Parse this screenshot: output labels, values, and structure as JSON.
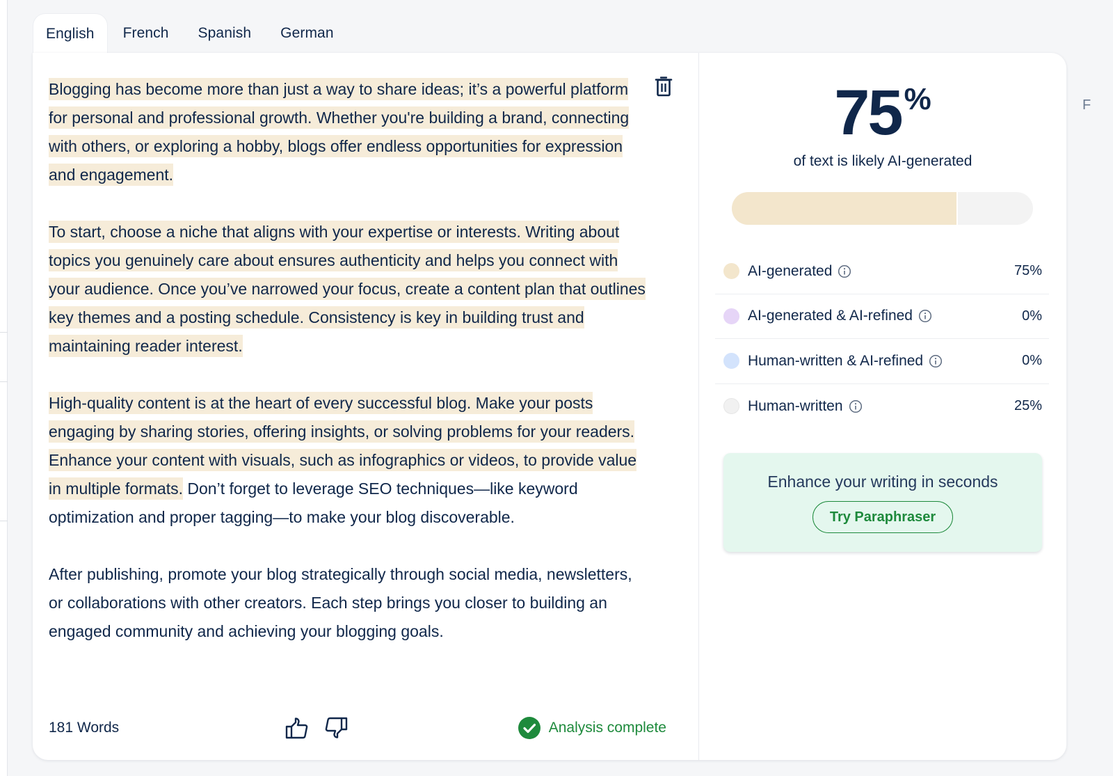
{
  "tabs": [
    {
      "label": "English",
      "active": true
    },
    {
      "label": "French",
      "active": false
    },
    {
      "label": "Spanish",
      "active": false
    },
    {
      "label": "German",
      "active": false
    }
  ],
  "right_edge_glyph": "F",
  "editor": {
    "paragraphs": [
      {
        "highlighted": "Blogging has become more than just a way to share ideas; it’s a powerful platform for personal and professional growth. Whether you're building a brand, connecting with others, or exploring a hobby, blogs offer endless opportunities for expression and engagement.",
        "plain": ""
      },
      {
        "highlighted": "To start, choose a niche that aligns with your expertise or interests. Writing about topics you genuinely care about ensures authenticity and helps you connect with your audience. Once you’ve narrowed your focus, create a content plan that outlines key themes and a posting schedule. Consistency is key in building trust and maintaining reader interest.",
        "plain": ""
      },
      {
        "highlighted": "High-quality content is at the heart of every successful blog. Make your posts engaging by sharing stories, offering insights, or solving problems for your readers. Enhance your content with visuals, such as infographics or videos, to provide value in multiple formats.",
        "plain": " Don’t forget to leverage SEO techniques—like keyword optimization and proper tagging—to make your blog discoverable."
      },
      {
        "highlighted": "",
        "plain": "After publishing, promote your blog strategically through social media, newsletters, or collaborations with other creators. Each step brings you closer to building an engaged community and achieving your blogging goals."
      }
    ],
    "word_count": "181 Words",
    "status": "Analysis complete",
    "icons": {
      "delete": "trash-icon",
      "like": "thumbs-up-icon",
      "dislike": "thumbs-down-icon",
      "status": "check-circle-icon"
    }
  },
  "results": {
    "score_value": "75",
    "score_suffix": "%",
    "score_caption": "of text is likely AI-generated",
    "ai_fraction": 0.75,
    "legend": [
      {
        "label": "AI-generated",
        "value": "75%",
        "color": "#f3e6cc"
      },
      {
        "label": "AI-generated & AI-refined",
        "value": "0%",
        "color": "#e6d5f7"
      },
      {
        "label": "Human-written & AI-refined",
        "value": "0%",
        "color": "#d3e3fc"
      },
      {
        "label": "Human-written",
        "value": "25%",
        "color": "#f1f1f1"
      }
    ],
    "promo": {
      "title": "Enhance your writing in seconds",
      "button": "Try Paraphraser"
    }
  },
  "colors": {
    "text": "#10274a",
    "highlight": "#f6ecd9",
    "success": "#1e8a3c",
    "promo_bg": "#e4f7ee"
  }
}
